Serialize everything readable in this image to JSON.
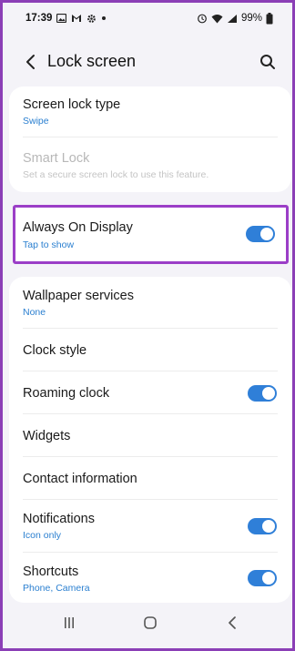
{
  "status": {
    "time": "17:39",
    "battery": "99%"
  },
  "header": {
    "title": "Lock screen"
  },
  "card1": {
    "screen_lock": {
      "title": "Screen lock type",
      "subtitle": "Swipe"
    },
    "smart_lock": {
      "title": "Smart Lock",
      "subtitle": "Set a secure screen lock to use this feature."
    }
  },
  "aod": {
    "title": "Always On Display",
    "subtitle": "Tap to show",
    "enabled": true
  },
  "card3": {
    "wallpaper": {
      "title": "Wallpaper services",
      "subtitle": "None"
    },
    "clock_style": {
      "title": "Clock style"
    },
    "roaming_clock": {
      "title": "Roaming clock",
      "enabled": true
    },
    "widgets": {
      "title": "Widgets"
    },
    "contact": {
      "title": "Contact information"
    },
    "notifications": {
      "title": "Notifications",
      "subtitle": "Icon only",
      "enabled": true
    },
    "shortcuts": {
      "title": "Shortcuts",
      "subtitle": "Phone, Camera",
      "enabled": true
    }
  },
  "colors": {
    "accent": "#2f7fd8",
    "highlight": "#9b3ec7",
    "frame": "#8b3fb6"
  },
  "icons": [
    "gallery-icon",
    "gmail-icon",
    "settings-icon",
    "dot-icon",
    "alarm-icon",
    "wifi-icon",
    "signal-icon",
    "battery-icon",
    "back-arrow-icon",
    "search-icon",
    "recents-icon",
    "home-icon",
    "nav-back-icon"
  ]
}
